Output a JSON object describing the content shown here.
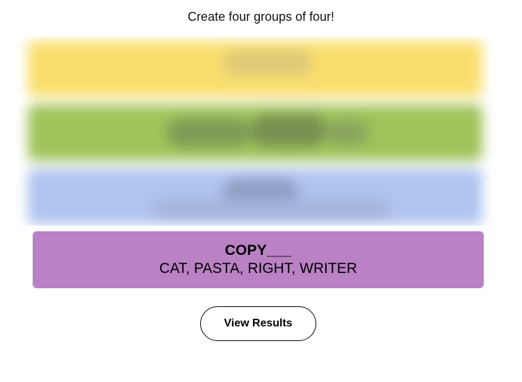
{
  "instructions": "Create four groups of four!",
  "solved_group": {
    "title": "COPY___",
    "members": "CAT, PASTA, RIGHT, WRITER",
    "color": "#ba81c5"
  },
  "hidden_groups": [
    {
      "color": "yellow",
      "hex": "#f9df6d"
    },
    {
      "color": "green",
      "hex": "#a0c35a"
    },
    {
      "color": "blue",
      "hex": "#b0c4ef"
    }
  ],
  "view_results_label": "View Results"
}
